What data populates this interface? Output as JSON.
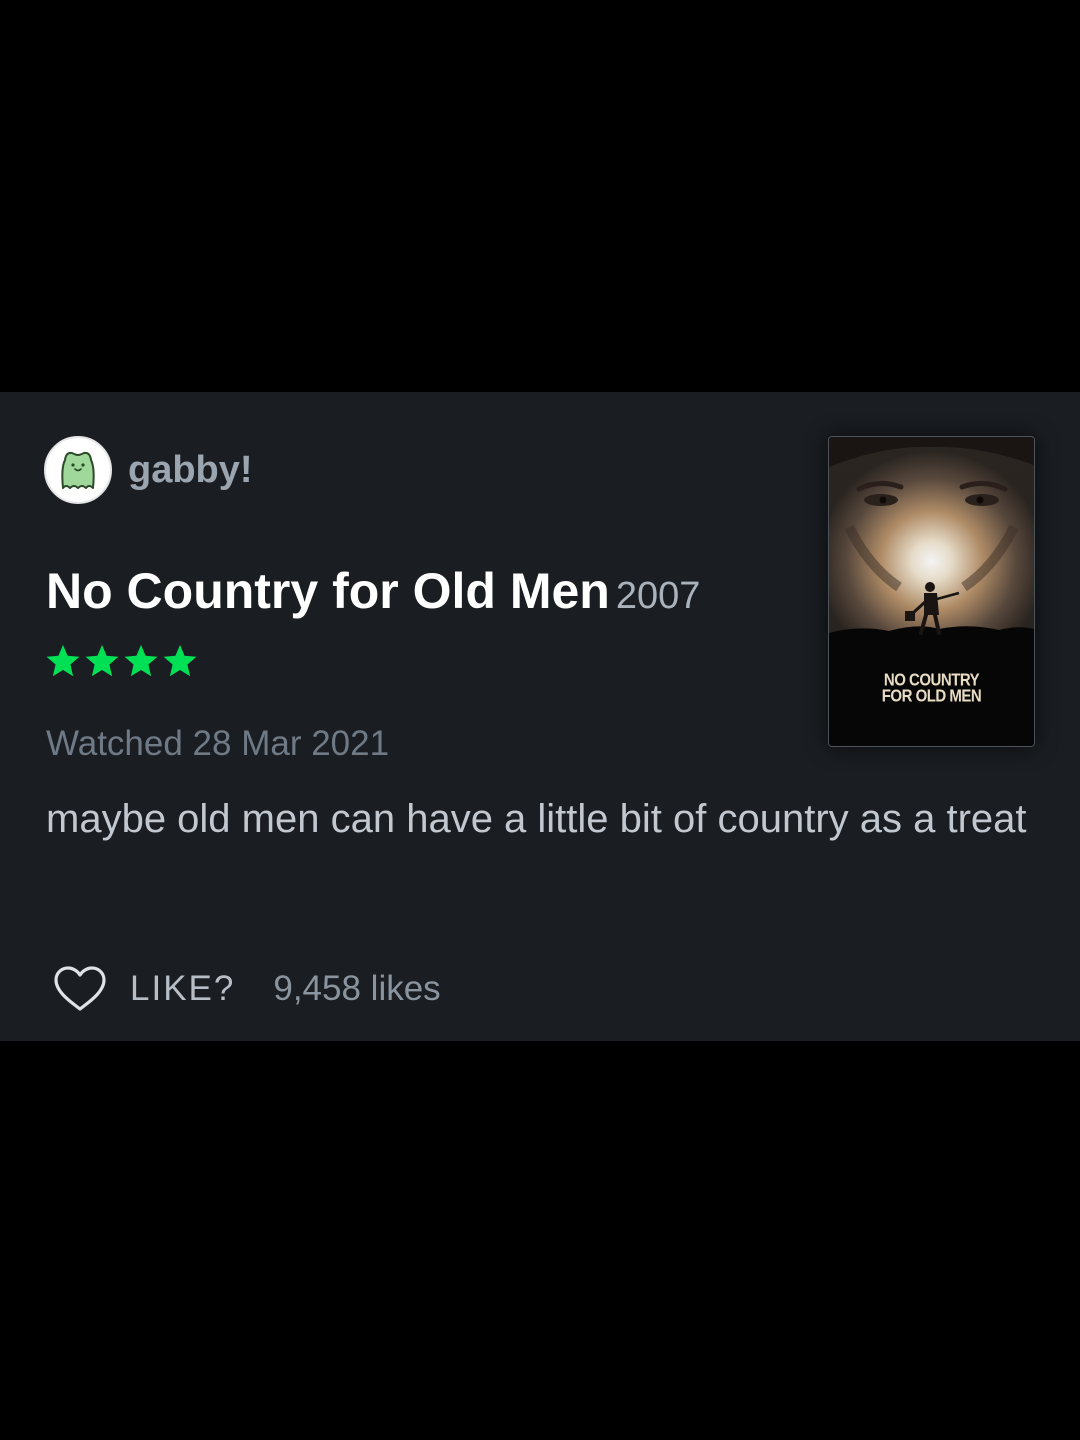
{
  "review": {
    "username": "gabby!",
    "film_title": "No Country for Old Men",
    "film_year": "2007",
    "rating_stars": 4,
    "star_color": "#00e054",
    "watched_text": "Watched 28 Mar 2021",
    "body": "maybe old men can have a little bit of country as a treat",
    "like_label": "LIKE?",
    "likes_count": "9,458 likes"
  },
  "poster": {
    "title_line1": "NO COUNTRY",
    "title_line2": "FOR OLD MEN"
  },
  "icons": {
    "avatar": "frog-avatar-icon",
    "star": "star-icon",
    "like": "heart-outline-icon"
  }
}
